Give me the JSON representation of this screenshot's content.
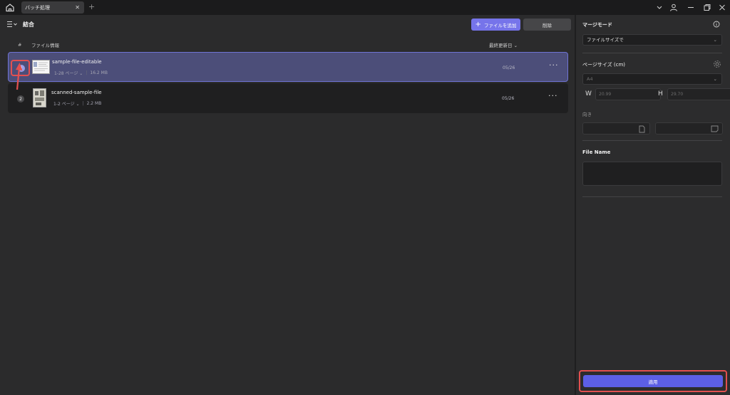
{
  "titlebar": {
    "tab_label": "バッチ処理",
    "close_glyph": "✕",
    "new_tab_glyph": "+"
  },
  "main": {
    "section_title": "結合",
    "add_file_label": "ファイルを追加",
    "add_file_icon": "+",
    "delete_label": "削除",
    "columns": {
      "hash": "#",
      "info": "ファイル情報",
      "date": "最終更新日 ⌄"
    },
    "rows": [
      {
        "index": "1",
        "name": "sample-file-editable",
        "pages": "1-28 ページ ⌄",
        "size": "16.2 MB",
        "date": "05/26",
        "selected": true
      },
      {
        "index": "2",
        "name": "scanned-sample-file",
        "pages": "1-2 ページ ⌄",
        "size": "2.2 MB",
        "date": "05/26",
        "selected": false
      }
    ],
    "more_glyph": "···",
    "meta_separator": "|"
  },
  "side": {
    "merge_mode_label": "マージモード",
    "merge_mode_value": "ファイルサイズで",
    "page_size_label": "ページサイズ (cm)",
    "page_size_value": "A4",
    "w_label": "W",
    "h_label": "H",
    "w_value": "20.99",
    "h_value": "29.70",
    "orientation_label": "向き",
    "file_name_label": "File Name",
    "apply_label": "適用",
    "caret_glyph": "⌄"
  },
  "colors": {
    "accent": "#7674ea",
    "apply": "#5c5fe6",
    "selected_row": "#4c4e79",
    "highlight": "#e35050"
  }
}
